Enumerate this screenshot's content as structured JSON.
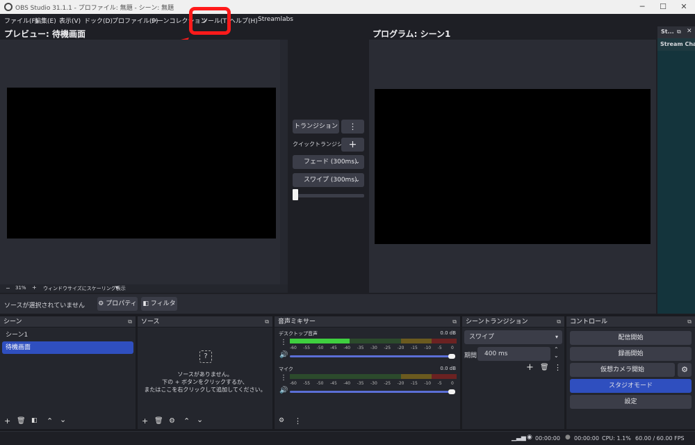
{
  "window": {
    "title": "OBS Studio 31.1.1 - プロファイル: 無題 - シーン: 無題",
    "minimize_icon": "minimize-icon",
    "maximize_icon": "maximize-icon",
    "close_icon": "close-icon"
  },
  "menu": [
    "ファイル(F)",
    "編集(E)",
    "表示(V)",
    "ドック(D)",
    "プロファイル(P)",
    "シーンコレクション",
    "ツール(T)",
    "ヘルプ(H)",
    "Streamlabs"
  ],
  "highlight": {
    "color": "#ff1a1a",
    "target": "ツール(T)"
  },
  "preview": {
    "title": "プレビュー: 待機画面",
    "zoom_minus": "−",
    "zoom": "31%",
    "zoom_plus": "+",
    "scale_mode": "ウィンドウサイズにスケーリング表示"
  },
  "program": {
    "title": "プログラム: シーン1"
  },
  "transition_panel": {
    "transition_button": "トランジション",
    "quick_transition_label": "クイックトランジション",
    "fade_button": "フェード (300ms)",
    "swipe_button": "スワイプ (300ms)",
    "tbar_value": 0
  },
  "stream_chat": {
    "tab": "St...",
    "title": "Stream Chat"
  },
  "source_toolbar": {
    "no_source": "ソースが選択されていません",
    "properties": "プロパティ",
    "filters": "フィルタ"
  },
  "scenes": {
    "title": "シーン",
    "items": [
      "シーン1",
      "待機画面"
    ],
    "selected": 1
  },
  "sources": {
    "title": "ソース",
    "empty_line1": "ソースがありません。",
    "empty_line2": "下の + ボタンをクリックするか、",
    "empty_line3": "またはここを右クリックして追加してください。"
  },
  "mixer": {
    "title": "音声ミキサー",
    "channels": [
      {
        "name": "デスクトップ音声",
        "db": "0.0 dB",
        "level": 0.36,
        "volume": 1.0
      },
      {
        "name": "マイク",
        "db": "0.0 dB",
        "level": 0.0,
        "volume": 1.0
      }
    ],
    "ticks": [
      "-60",
      "-55",
      "-50",
      "-45",
      "-40",
      "-35",
      "-30",
      "-25",
      "-20",
      "-15",
      "-10",
      "-5",
      "0"
    ]
  },
  "scene_transition": {
    "title": "シーントランジション",
    "selected": "スワイプ",
    "duration_label": "期間",
    "duration_value": "400 ms"
  },
  "controls": {
    "title": "コントロール",
    "start_stream": "配信開始",
    "start_record": "録画開始",
    "virtual_camera": "仮想カメラ開始",
    "studio_mode": "スタジオモード",
    "settings": "設定"
  },
  "status": {
    "stream_time": "00:00:00",
    "record_time": "00:00:00",
    "cpu": "CPU: 1.1%",
    "fps": "60.00 / 60.00 FPS"
  }
}
